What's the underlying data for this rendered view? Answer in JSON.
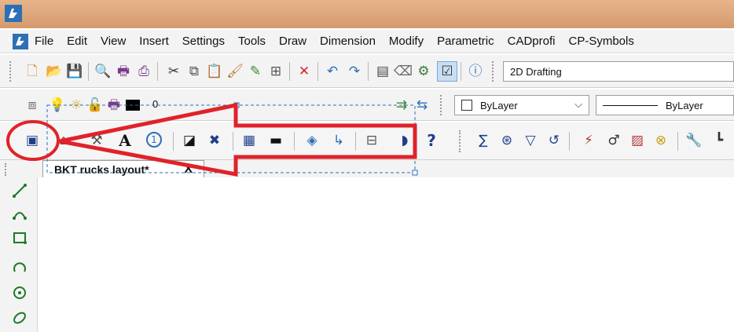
{
  "menu": {
    "items": [
      "File",
      "Edit",
      "View",
      "Insert",
      "Settings",
      "Tools",
      "Draw",
      "Dimension",
      "Modify",
      "Parametric",
      "CADprofi",
      "CP-Symbols"
    ]
  },
  "toolbar": {
    "workspace_value": "2D Drafting",
    "layer_value": "0",
    "color_value": "ByLayer",
    "linetype_value": "ByLayer"
  },
  "toolbar3": {
    "help_glyph": "?",
    "text_glyph": "A",
    "number_glyph": "1"
  },
  "tab": {
    "title": "BKT rucks layout*",
    "close": "X"
  },
  "colors": {
    "titlebar": "#dca479",
    "highlight_red": "#e0222a",
    "accent_blue": "#2d6fb4"
  }
}
